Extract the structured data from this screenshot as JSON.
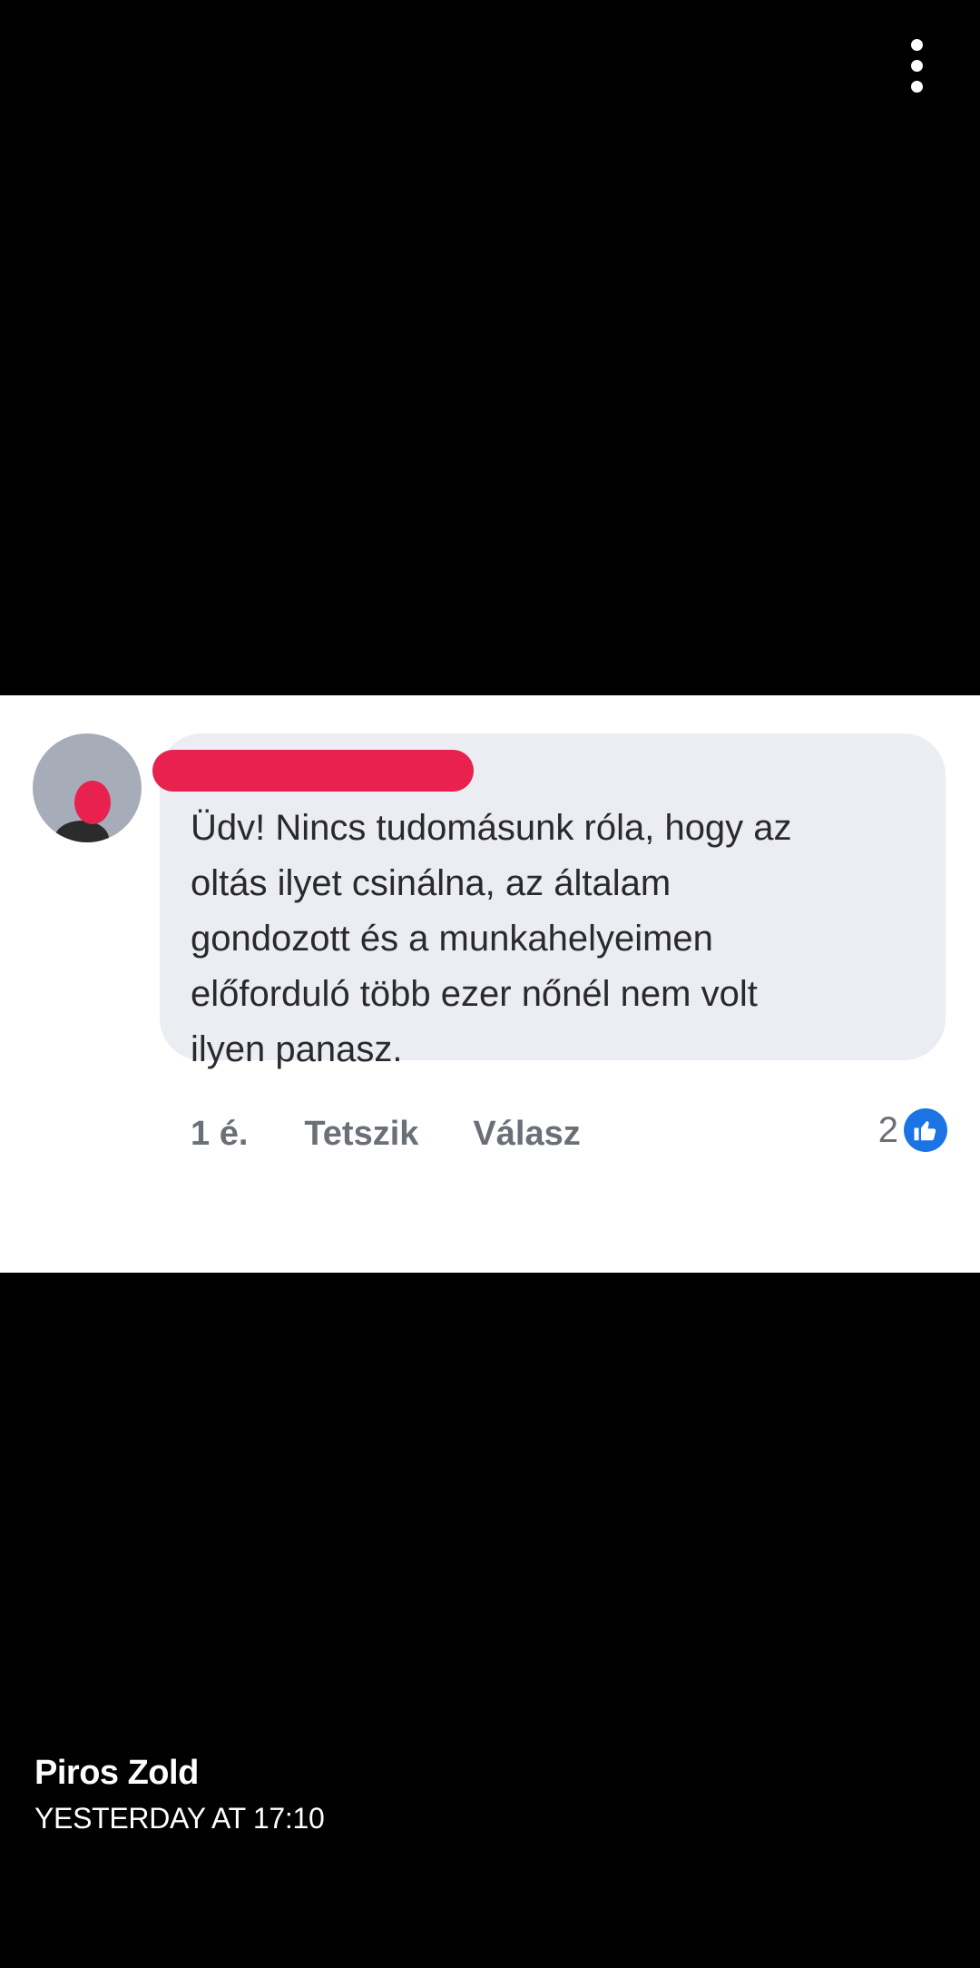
{
  "viewer": {
    "menu_icon": "more-vertical-icon",
    "caption": {
      "author": "Piros Zold",
      "timestamp": "YESTERDAY AT 17:10"
    }
  },
  "comment": {
    "text_lines": [
      "Üdv! Nincs tudomásunk róla, hogy az",
      "oltás ilyet csinálna, az általam",
      "gondozott és a munkahelyeimen",
      "előforduló több ezer nőnél nem volt",
      "ilyen panasz."
    ],
    "time_ago": "1 é.",
    "like_label": "Tetszik",
    "reply_label": "Válasz",
    "reaction_count": "2",
    "reaction_icon": "thumbs-up-icon"
  },
  "colors": {
    "background": "#000000",
    "bubble": "#ebedf3",
    "redaction": "#e8214f",
    "like_blue": "#1b74e4",
    "action_gray": "#6b6f76"
  }
}
